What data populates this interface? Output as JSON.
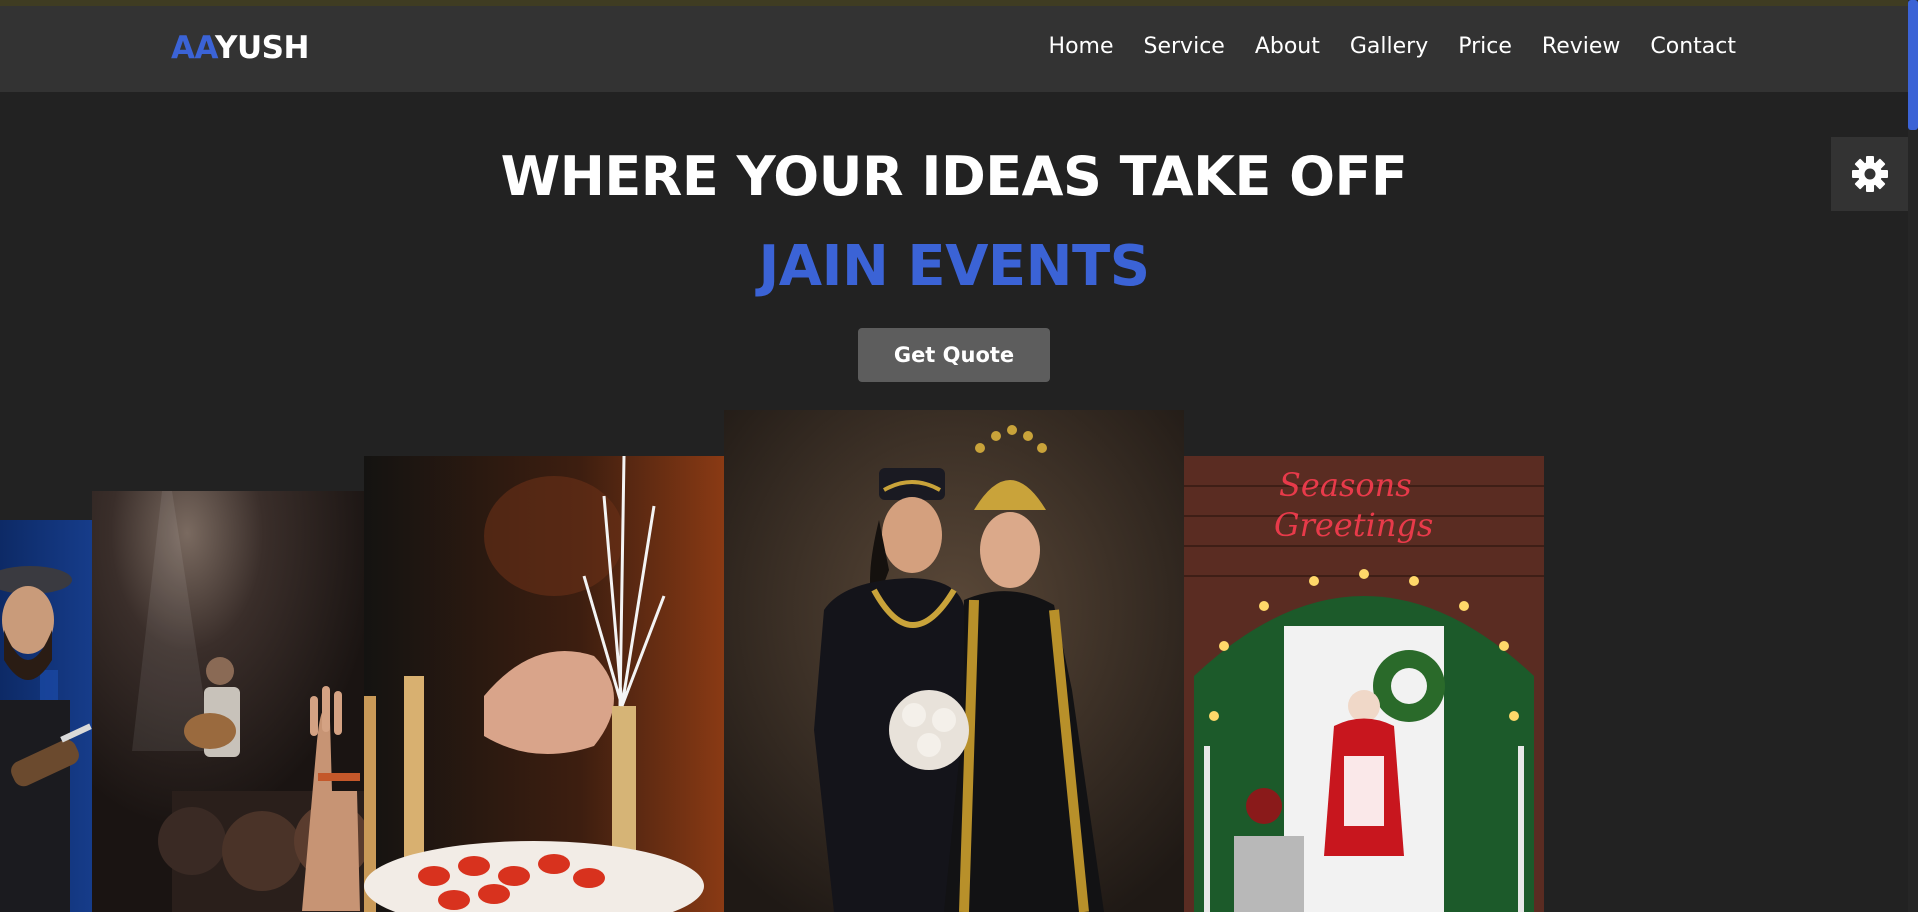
{
  "brand": {
    "logo_accent": "AA",
    "logo_rest": "YUSH"
  },
  "nav": [
    {
      "label": "Home"
    },
    {
      "label": "Service"
    },
    {
      "label": "About"
    },
    {
      "label": "Gallery"
    },
    {
      "label": "Price"
    },
    {
      "label": "Review"
    },
    {
      "label": "Contact"
    }
  ],
  "hero": {
    "headline": "WHERE YOUR IDEAS TAKE OFF",
    "subheadline": "JAIN EVENTS",
    "cta_label": "Get Quote"
  },
  "gallery": {
    "sign_text": "Seasons Greetings"
  },
  "icons": {
    "settings": "gear-icon"
  },
  "colors": {
    "accent": "#3b63d6",
    "background": "#222222",
    "navbar": "#333333",
    "button": "#5d5d5d"
  }
}
